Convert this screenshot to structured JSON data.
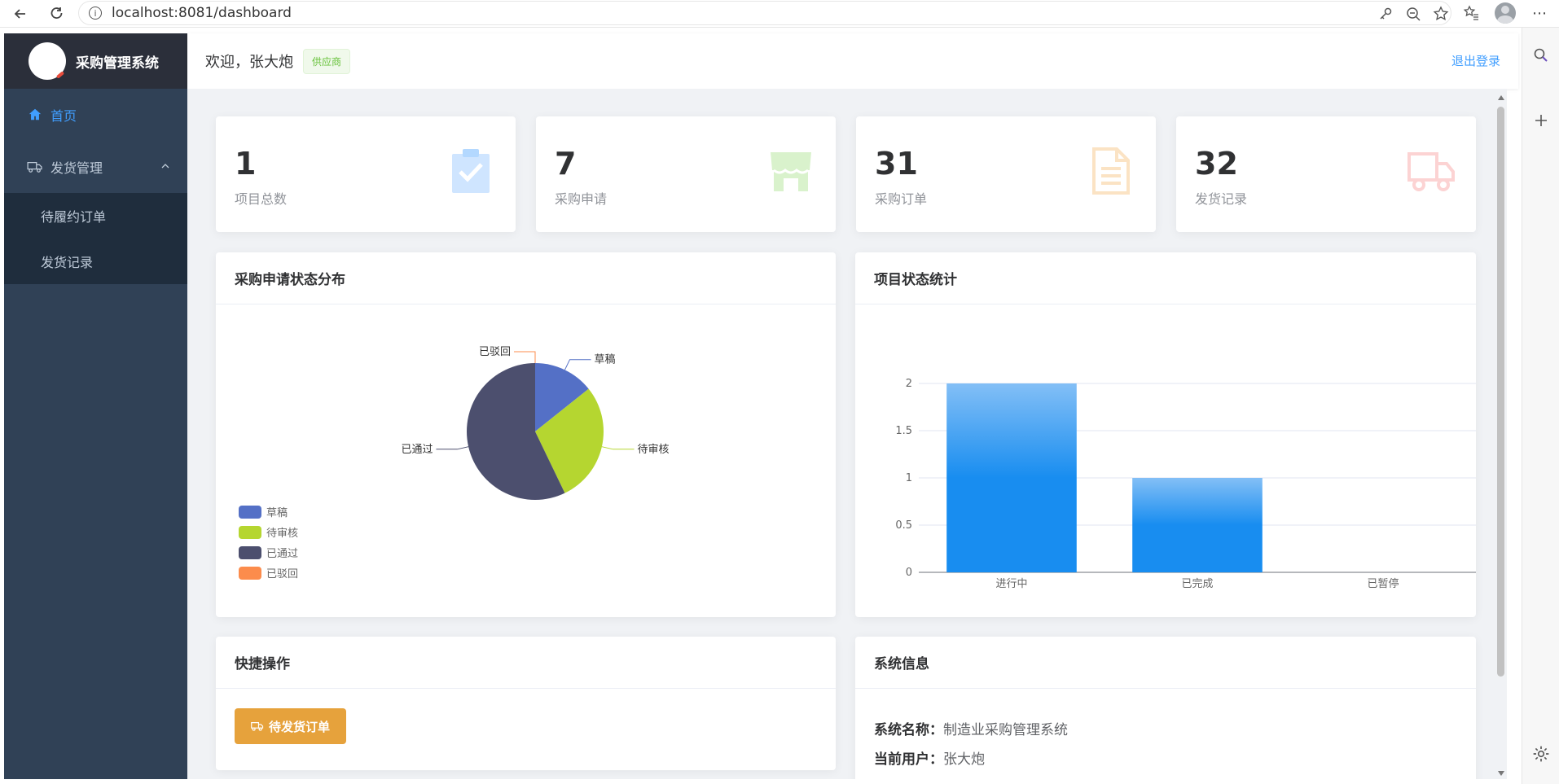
{
  "browser": {
    "url": "localhost:8081/dashboard"
  },
  "sidebar": {
    "title": "采购管理系统",
    "items": [
      {
        "label": "首页",
        "icon": "home-icon",
        "active": true
      },
      {
        "label": "发货管理",
        "icon": "truck-icon",
        "expanded": true,
        "children": [
          {
            "label": "待履约订单"
          },
          {
            "label": "发货记录"
          }
        ]
      }
    ]
  },
  "header": {
    "welcome": "欢迎，张大炮",
    "role": "供应商",
    "logout": "退出登录"
  },
  "stats": [
    {
      "value": "1",
      "label": "项目总数",
      "icon": "clipboard-check-icon",
      "color": "#409eff"
    },
    {
      "value": "7",
      "label": "采购申请",
      "icon": "shop-icon",
      "color": "#67c23a"
    },
    {
      "value": "31",
      "label": "采购订单",
      "icon": "document-icon",
      "color": "#e6a23c"
    },
    {
      "value": "32",
      "label": "发货记录",
      "icon": "truck-icon",
      "color": "#f56c6c"
    }
  ],
  "pie_panel": {
    "title": "采购申请状态分布"
  },
  "bar_panel": {
    "title": "项目状态统计"
  },
  "quick": {
    "title": "快捷操作",
    "button": "待发货订单"
  },
  "system": {
    "title": "系统信息",
    "name_label": "系统名称：",
    "name_value": "制造业采购管理系统",
    "user_label": "当前用户：",
    "user_value": "张大炮"
  },
  "chart_data": [
    {
      "type": "pie",
      "title": "",
      "categories": [
        "草稿",
        "待审核",
        "已通过",
        "已驳回"
      ],
      "values": [
        1,
        2,
        4,
        0
      ],
      "colors": [
        "#5470c6",
        "#b5d630",
        "#4c4f6e",
        "#fc8c4c"
      ],
      "legend": "bottom-left"
    },
    {
      "type": "bar",
      "title": "",
      "categories": [
        "进行中",
        "已完成",
        "已暂停"
      ],
      "values": [
        2,
        1,
        0
      ],
      "ylim": [
        0,
        2
      ],
      "yticks": [
        "0",
        "0.5",
        "1",
        "1.5",
        "2"
      ],
      "grid": true
    }
  ]
}
